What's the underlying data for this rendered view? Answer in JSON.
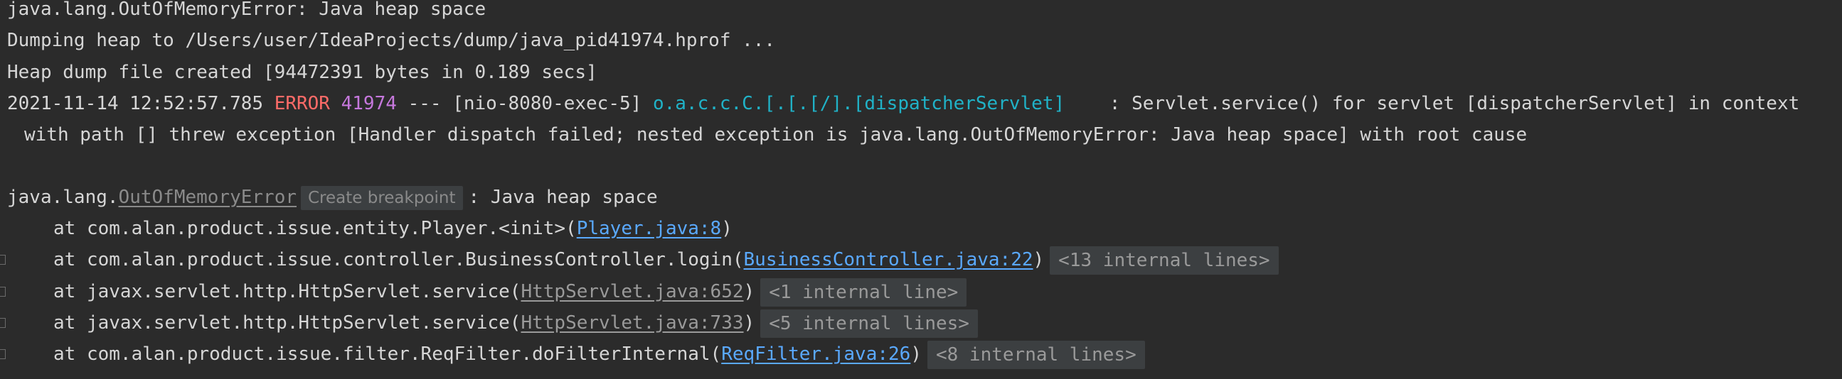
{
  "lines": {
    "oom_header": "java.lang.OutOfMemoryError: Java heap space",
    "dumping": "Dumping heap to /Users/user/IdeaProjects/dump/java_pid41974.hprof ...",
    "dump_created": "Heap dump file created [94472391 bytes in 0.189 secs]",
    "log_timestamp": "2021-11-14 12:52:57.785",
    "log_level": "ERROR",
    "log_pid": "41974",
    "log_sep": "---",
    "log_thread": "[nio-8080-exec-5]",
    "log_logger": "o.a.c.c.C.[.[.[/].[dispatcherServlet]",
    "log_message": ": Servlet.service() for servlet [dispatcherServlet] in context",
    "log_continuation": "with path [] threw exception [Handler dispatch failed; nested exception is java.lang.OutOfMemoryError: Java heap space] with root cause",
    "exc_prefix": "java.lang.",
    "exc_class": "OutOfMemoryError",
    "create_breakpoint": "Create breakpoint",
    "exc_message": ": Java heap space"
  },
  "stack_trace": [
    {
      "frame": "at com.alan.product.issue.entity.Player.<init>(",
      "link": "Player.java:8",
      "suffix": ")",
      "internal": ""
    },
    {
      "frame": "at com.alan.product.issue.controller.BusinessController.login(",
      "link": "BusinessController.java:22",
      "suffix": ")",
      "internal": "<13 internal lines>"
    },
    {
      "frame": "at javax.servlet.http.HttpServlet.service(",
      "link": "HttpServlet.java:652",
      "suffix": ")",
      "internal": "<1 internal line>"
    },
    {
      "frame": "at javax.servlet.http.HttpServlet.service(",
      "link": "HttpServlet.java:733",
      "suffix": ")",
      "internal": "<5 internal lines>"
    },
    {
      "frame": "at com.alan.product.issue.filter.ReqFilter.doFilterInternal(",
      "link": "ReqFilter.java:26",
      "suffix": ")",
      "internal": "<8 internal lines>"
    }
  ],
  "colors": {
    "background": "#2b2b2b",
    "text": "#d6d6d6",
    "error": "#ff6b68",
    "pid": "#c678dd",
    "logger": "#20b2c7",
    "link": "#5aa9ff"
  }
}
